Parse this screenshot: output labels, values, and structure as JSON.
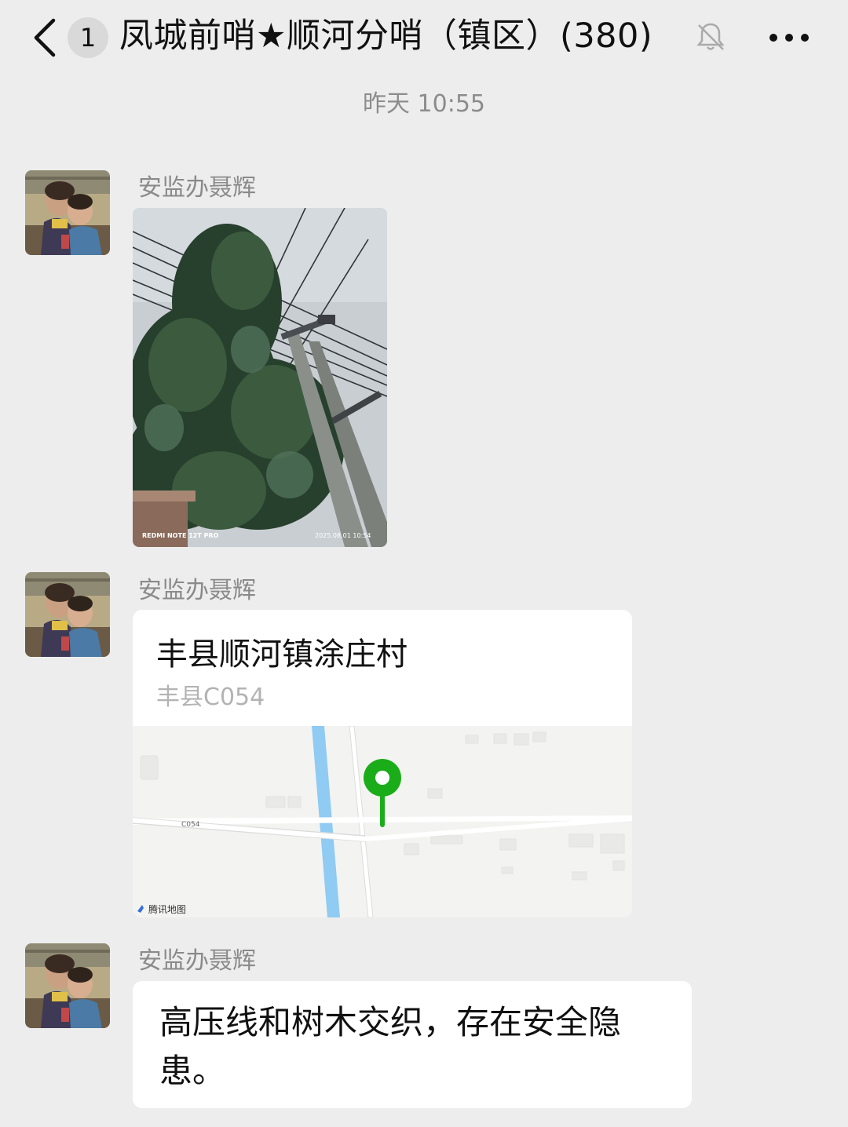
{
  "header": {
    "unread_count": "1",
    "title": "凤城前哨★顺河分哨（镇区）(380)",
    "icons": [
      "back-arrow-icon",
      "mute-bell-icon",
      "more-dots-icon"
    ]
  },
  "timestamp": "昨天 10:55",
  "messages": [
    {
      "sender": "安监办聂辉",
      "type": "image",
      "watermark_left": "REDMI NOTE 12T PRO",
      "watermark_right": "2025.08.01 10:54"
    },
    {
      "sender": "安监办聂辉",
      "type": "location",
      "place_name": "丰县顺河镇涂庄村",
      "address": "丰县C054",
      "map_road_label": "C054",
      "map_provider": "腾讯地图"
    },
    {
      "sender": "安监办聂辉",
      "type": "text",
      "text": "高压线和树木交织，存在安全隐患。"
    }
  ],
  "colors": {
    "background": "#ededed",
    "bubble": "#ffffff",
    "pin": "#1aad19",
    "river": "#8fcbf2"
  }
}
